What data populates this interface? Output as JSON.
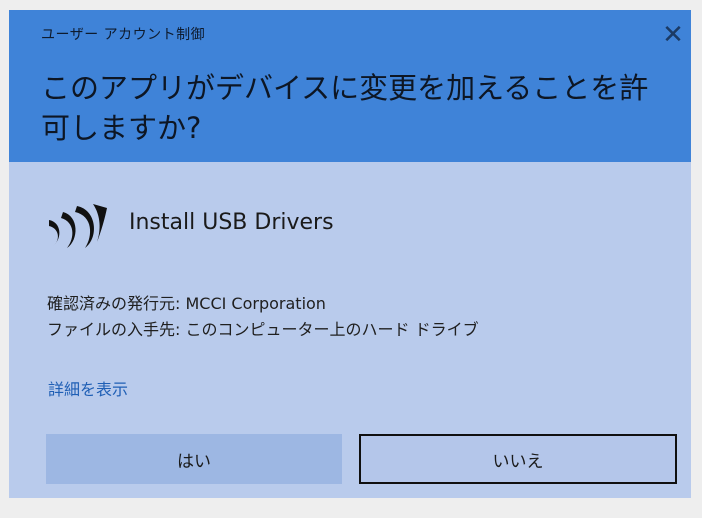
{
  "dialog": {
    "title": "ユーザー アカウント制御",
    "close_label": "✕",
    "question": "このアプリがデバイスに変更を加えることを許可しますか?",
    "app_name": "Install USB Drivers",
    "publisher_line": "確認済みの発行元: MCCI Corporation",
    "origin_line": "ファイルの入手先: このコンピューター上のハード ドライブ",
    "show_details": "詳細を表示",
    "yes_button": "はい",
    "no_button": "いいえ"
  },
  "icons": {
    "close": "close-icon",
    "app_logo": "mcci-logo-icon"
  },
  "colors": {
    "header": "#3f83d8",
    "body": "#b9cbec",
    "link": "#1f5fb5",
    "yes_button": "#9db7e3",
    "no_button": "#b4c6ea"
  }
}
